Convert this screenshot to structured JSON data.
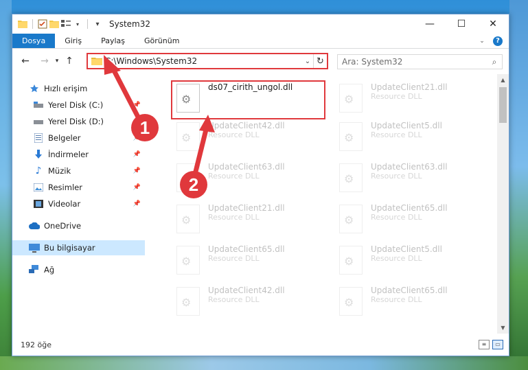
{
  "window": {
    "title": "System32"
  },
  "ribbon": {
    "tabs": [
      {
        "label": "Dosya",
        "active": true
      },
      {
        "label": "Giriş",
        "active": false
      },
      {
        "label": "Paylaş",
        "active": false
      },
      {
        "label": "Görünüm",
        "active": false
      }
    ],
    "help_label": "?"
  },
  "navbar": {
    "address_path": "C:\\Windows\\System32",
    "search_placeholder": "Ara: System32"
  },
  "sidebar": {
    "items": [
      {
        "label": "Hızlı erişim",
        "icon": "star-icon",
        "pinned": false
      },
      {
        "label": "Yerel Disk (C:)",
        "icon": "drive-icon",
        "pinned": true
      },
      {
        "label": "Yerel Disk (D:)",
        "icon": "drive-icon",
        "pinned": true
      },
      {
        "label": "Belgeler",
        "icon": "documents-icon",
        "pinned": true
      },
      {
        "label": "İndirmeler",
        "icon": "download-icon",
        "pinned": true
      },
      {
        "label": "Müzik",
        "icon": "music-icon",
        "pinned": true
      },
      {
        "label": "Resimler",
        "icon": "pictures-icon",
        "pinned": true
      },
      {
        "label": "Videolar",
        "icon": "video-icon",
        "pinned": true
      },
      {
        "label": "OneDrive",
        "icon": "cloud-icon",
        "pinned": false
      },
      {
        "label": "Bu bilgisayar",
        "icon": "computer-icon",
        "pinned": false,
        "selected": true
      },
      {
        "label": "Ağ",
        "icon": "network-icon",
        "pinned": false
      }
    ]
  },
  "files": {
    "col1": [
      {
        "name": "ds07_cirith_ungol.dll",
        "type": ""
      },
      {
        "name": "UpdateClient42.dll",
        "type": "Resource DLL"
      },
      {
        "name": "UpdateClient63.dll",
        "type": "Resource DLL"
      },
      {
        "name": "UpdateClient21.dll",
        "type": "Resource DLL"
      },
      {
        "name": "UpdateClient65.dll",
        "type": "Resource DLL"
      },
      {
        "name": "UpdateClient42.dll",
        "type": "Resource DLL"
      }
    ],
    "col2": [
      {
        "name": "UpdateClient21.dll",
        "type": "Resource DLL"
      },
      {
        "name": "UpdateClient5.dll",
        "type": "Resource DLL"
      },
      {
        "name": "UpdateClient63.dll",
        "type": "Resource DLL"
      },
      {
        "name": "UpdateClient65.dll",
        "type": "Resource DLL"
      },
      {
        "name": "UpdateClient5.dll",
        "type": "Resource DLL"
      },
      {
        "name": "UpdateClient65.dll",
        "type": "Resource DLL"
      }
    ]
  },
  "status": {
    "item_count": "192 öğe"
  },
  "annotations": {
    "badge1": "1",
    "badge2": "2"
  },
  "colors": {
    "accent": "#1979ca",
    "highlight": "#e0383c",
    "selection": "#cce8ff"
  }
}
